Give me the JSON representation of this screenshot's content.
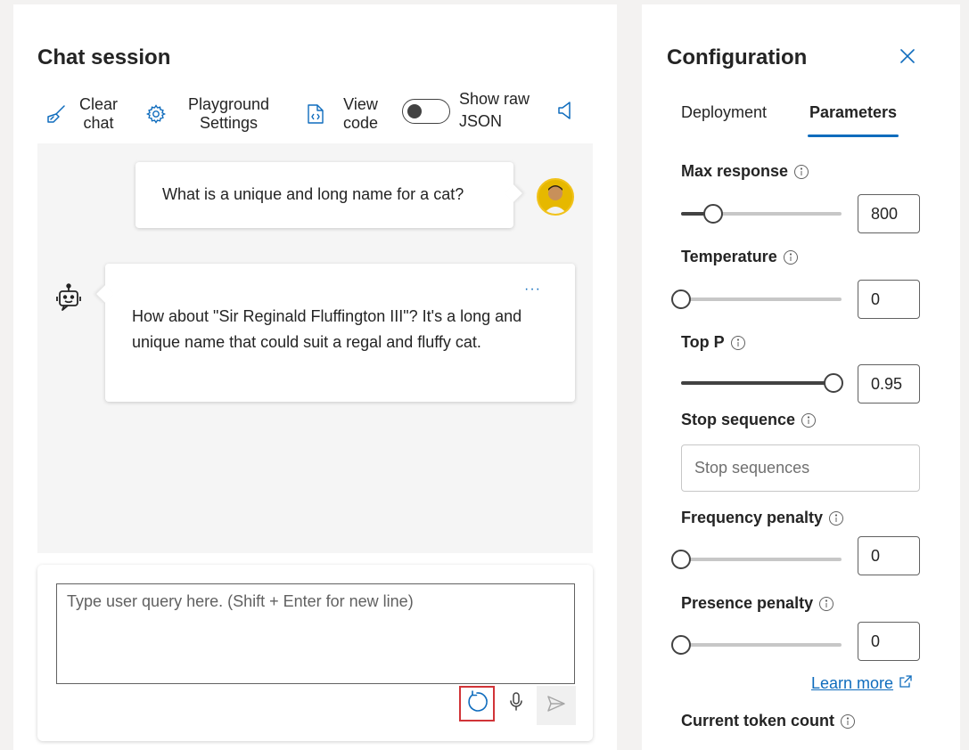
{
  "chat": {
    "title": "Chat session",
    "toolbar": {
      "clear_line1": "Clear",
      "clear_line2": "chat",
      "settings_line1": "Playground",
      "settings_line2": "Settings",
      "view_line1": "View",
      "view_line2": "code",
      "json_line1": "Show raw",
      "json_line2": "JSON",
      "show_raw_json": false
    },
    "messages": {
      "user": "What is a unique and long name for a cat?",
      "assistant": "How about \"Sir Reginald Fluffington III\"? It's a long and unique name that could suit a regal and fluffy cat.",
      "more": "···"
    },
    "input": {
      "placeholder": "Type user query here. (Shift + Enter for new line)",
      "value": ""
    }
  },
  "config": {
    "title": "Configuration",
    "tabs": {
      "deployment": "Deployment",
      "parameters": "Parameters",
      "active": "parameters"
    },
    "params": {
      "max_response": {
        "label": "Max response",
        "value": "800",
        "fraction": 0.2
      },
      "temperature": {
        "label": "Temperature",
        "value": "0",
        "fraction": 0
      },
      "top_p": {
        "label": "Top P",
        "value": "0.95",
        "fraction": 0.95
      },
      "stop_sequence": {
        "label": "Stop sequence",
        "placeholder": "Stop sequences"
      },
      "frequency_penalty": {
        "label": "Frequency penalty",
        "value": "0",
        "fraction": 0
      },
      "presence_penalty": {
        "label": "Presence penalty",
        "value": "0",
        "fraction": 0
      }
    },
    "learn_more": "Learn more",
    "token_count_label": "Current token count"
  },
  "colors": {
    "accent": "#0f6cbd",
    "highlight_border": "#d13438",
    "chat_background": "#f5f5f5"
  }
}
